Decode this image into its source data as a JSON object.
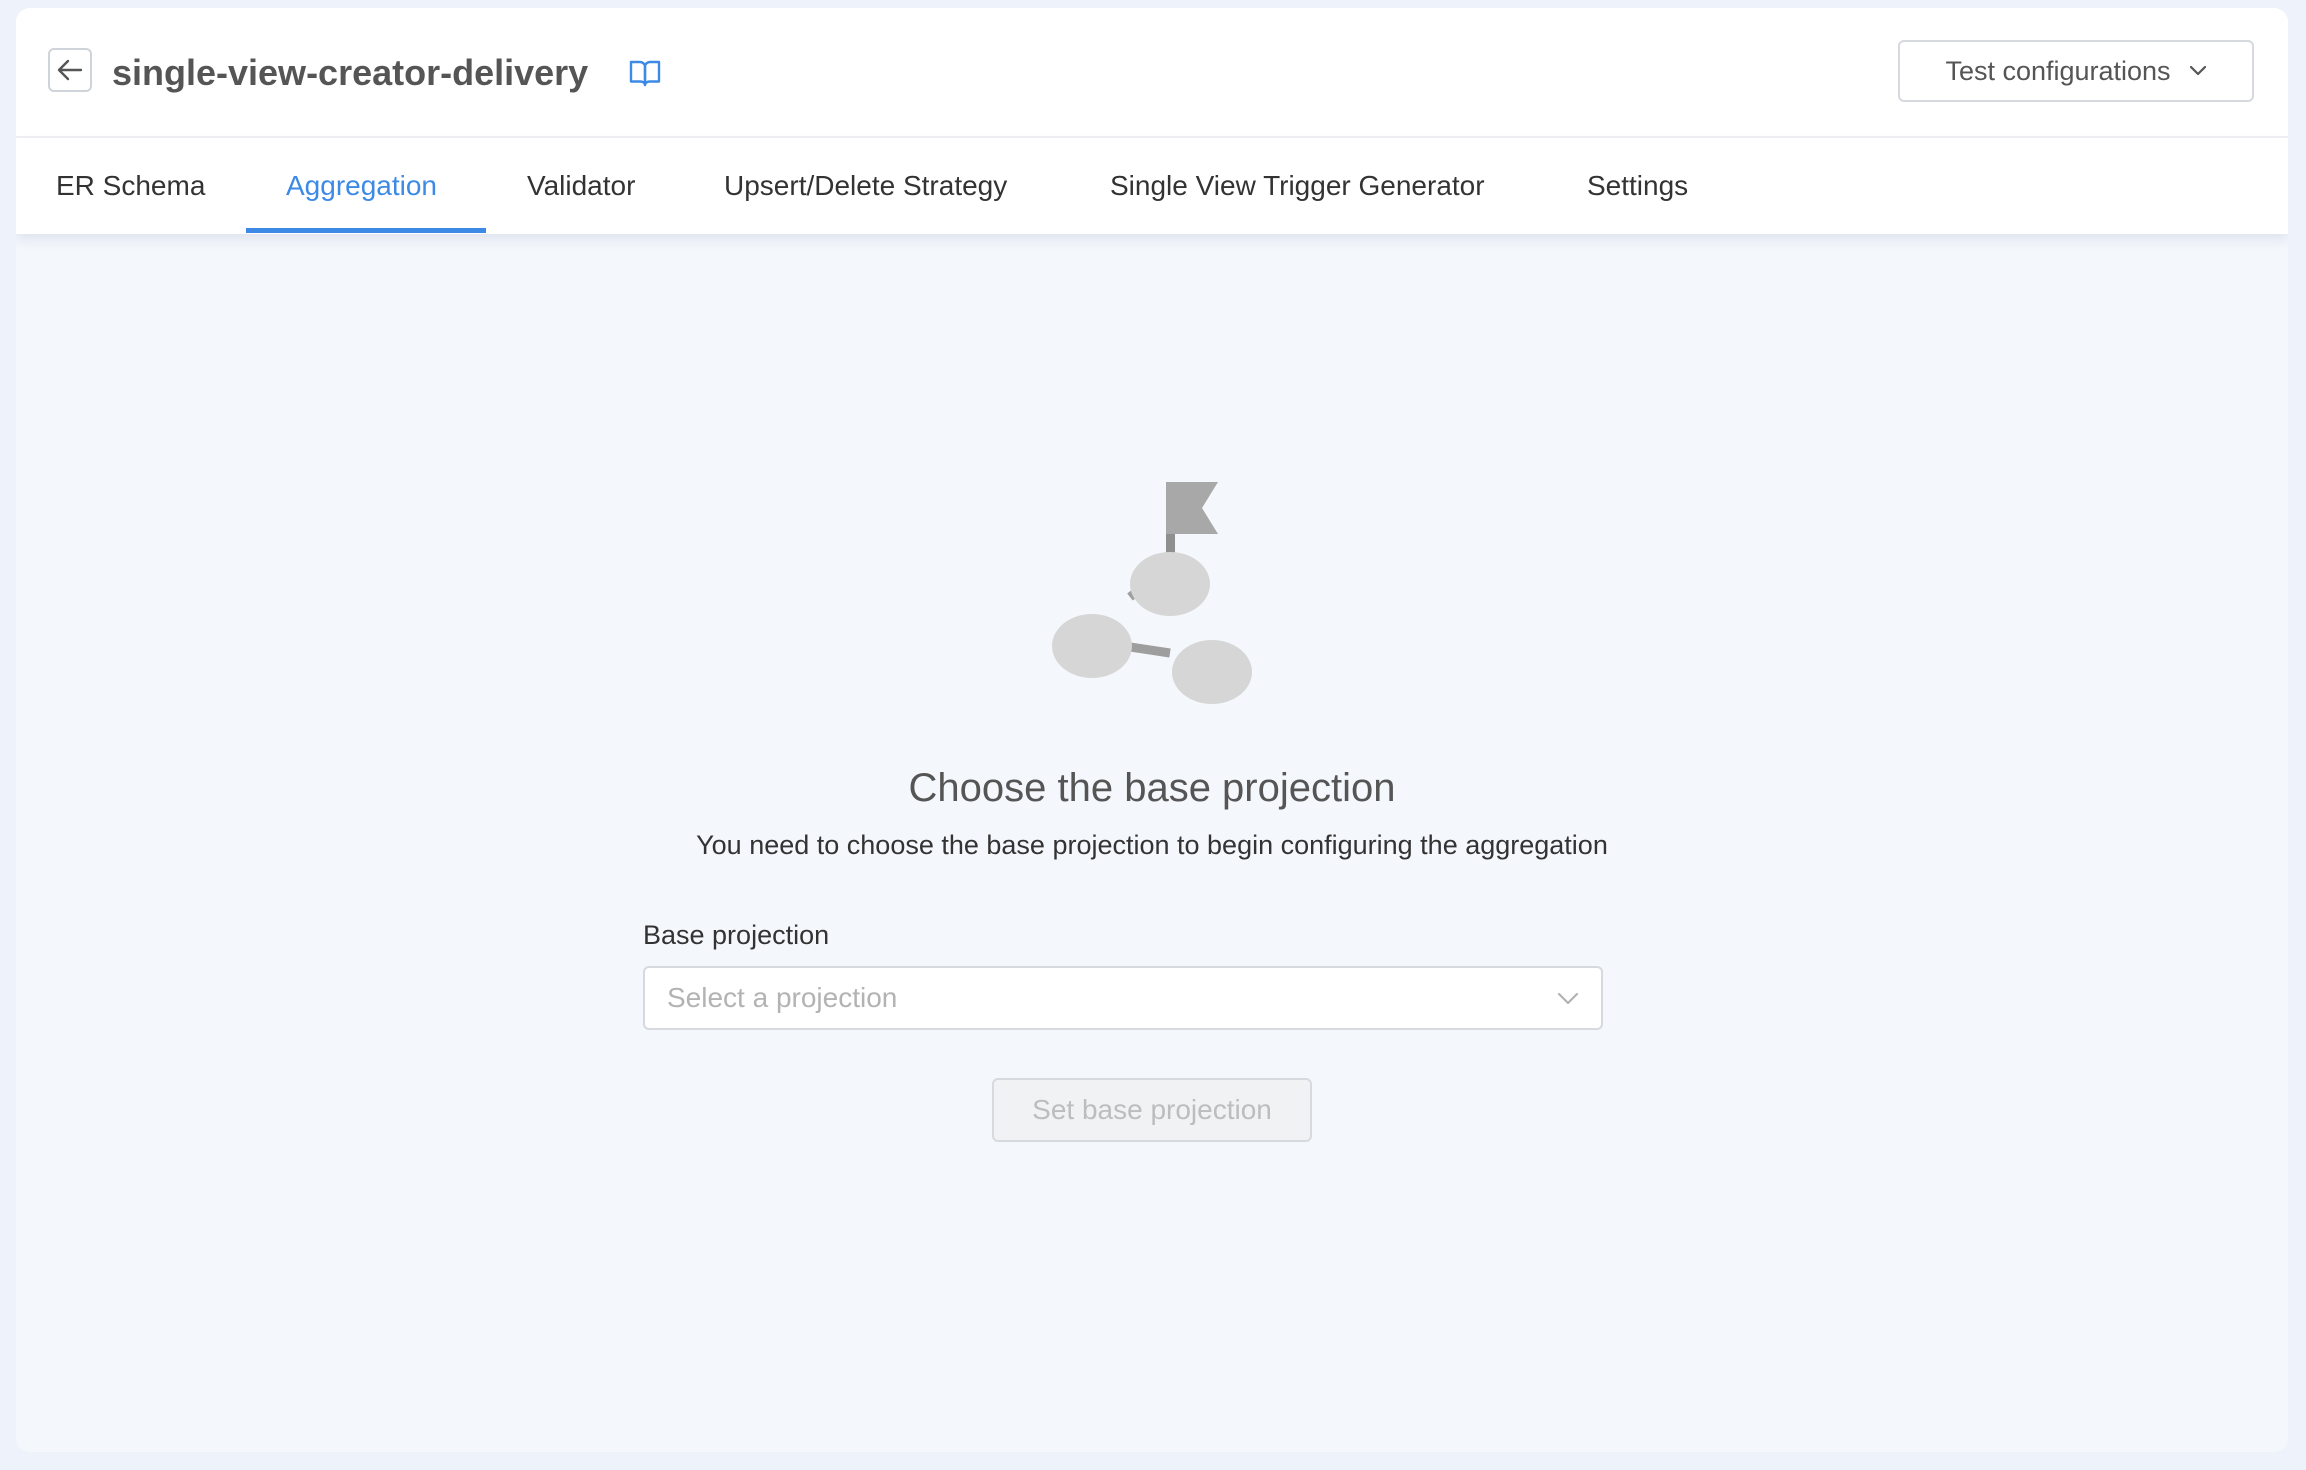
{
  "header": {
    "back_icon": "arrow-left-icon",
    "title": "single-view-creator-delivery",
    "docs_icon": "book-open-icon",
    "config_button_label": "Test configurations",
    "config_button_icon": "chevron-down-icon"
  },
  "tabs": [
    {
      "label": "ER Schema",
      "active": false
    },
    {
      "label": "Aggregation",
      "active": true
    },
    {
      "label": "Validator",
      "active": false
    },
    {
      "label": "Upsert/Delete Strategy",
      "active": false
    },
    {
      "label": "Single View Trigger Generator",
      "active": false
    },
    {
      "label": "Settings",
      "active": false
    }
  ],
  "empty_state": {
    "illustration": "flag-graph-illustration",
    "title": "Choose the base projection",
    "description": "You need to choose the base projection to begin configuring the aggregation"
  },
  "form": {
    "label": "Base projection",
    "placeholder": "Select a projection",
    "submit_label": "Set base projection",
    "submit_disabled": true
  },
  "colors": {
    "accent": "#3d8ae6",
    "background": "#f4f7fc",
    "disabled_text": "#bdbdbd"
  }
}
